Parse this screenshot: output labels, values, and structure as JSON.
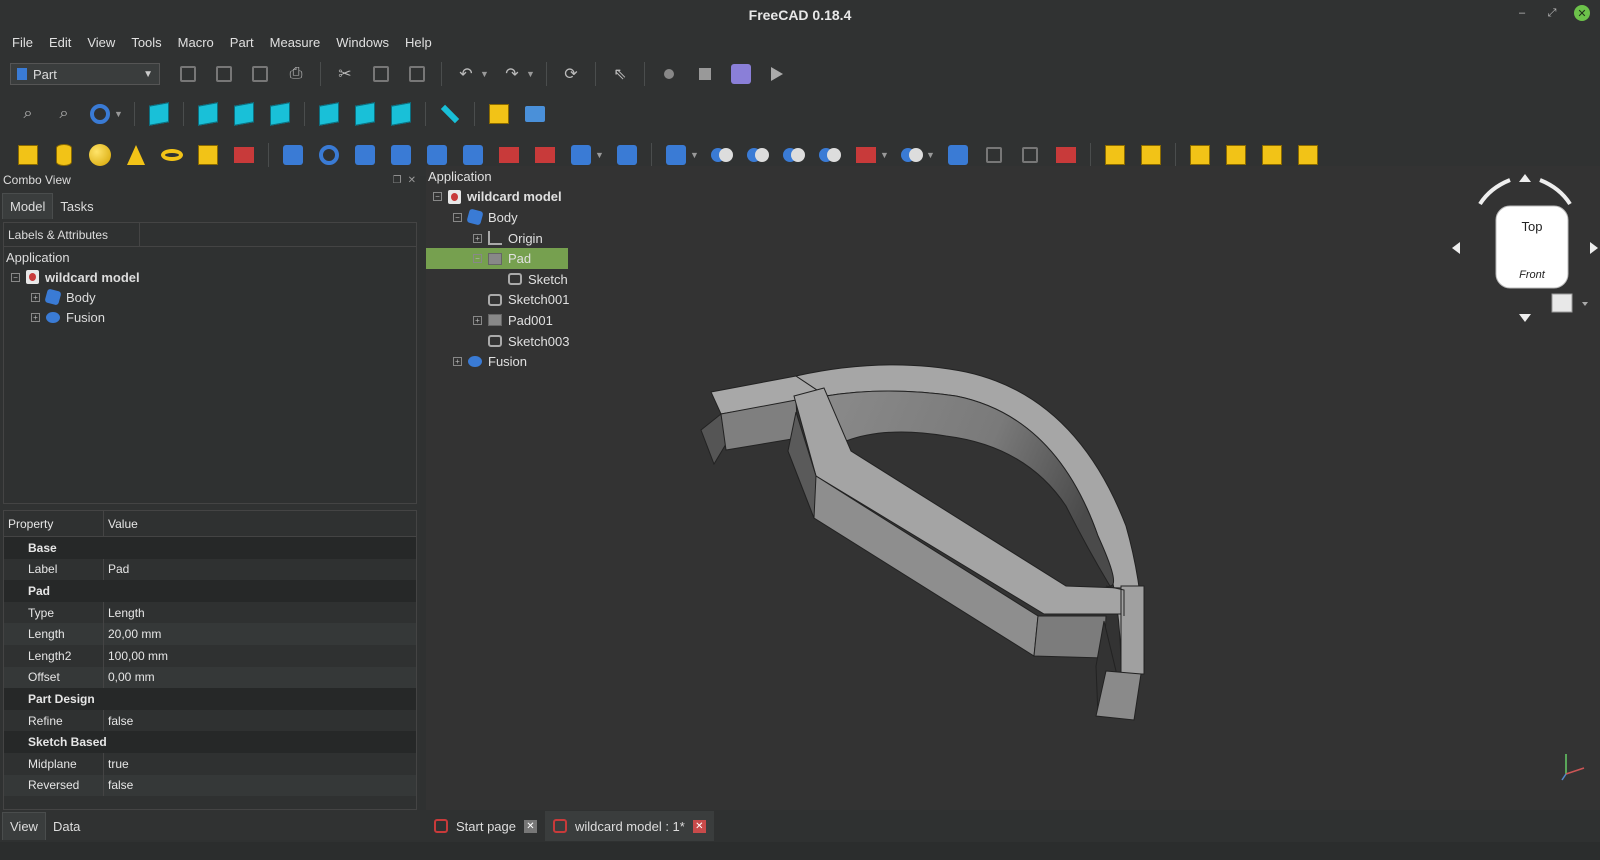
{
  "window": {
    "title": "FreeCAD 0.18.4"
  },
  "menu": [
    "File",
    "Edit",
    "View",
    "Tools",
    "Macro",
    "Part",
    "Measure",
    "Windows",
    "Help"
  ],
  "toolbar": {
    "workbench": "Part"
  },
  "combo": {
    "title": "Combo View",
    "tabs": [
      "Model",
      "Tasks"
    ],
    "tree_header": "Labels & Attributes",
    "tree_root": "Application",
    "tree": [
      {
        "label": "wildcard model",
        "level": 0,
        "bold": true
      },
      {
        "label": "Body",
        "level": 1
      },
      {
        "label": "Fusion",
        "level": 1
      }
    ],
    "prop_header": {
      "property": "Property",
      "value": "Value"
    },
    "groups": {
      "base": "Base",
      "pad": "Pad",
      "part_design": "Part Design",
      "sketch_based": "Sketch Based"
    },
    "props": {
      "label": {
        "name": "Label",
        "value": "Pad"
      },
      "type": {
        "name": "Type",
        "value": "Length"
      },
      "length": {
        "name": "Length",
        "value": "20,00 mm"
      },
      "length2": {
        "name": "Length2",
        "value": "100,00 mm"
      },
      "offset": {
        "name": "Offset",
        "value": "0,00 mm"
      },
      "refine": {
        "name": "Refine",
        "value": "false"
      },
      "midplane": {
        "name": "Midplane",
        "value": "true"
      },
      "reversed": {
        "name": "Reversed",
        "value": "false"
      }
    },
    "bottom_tabs": [
      "View",
      "Data"
    ]
  },
  "view_tree": {
    "root": "Application",
    "doc": "wildcard model",
    "body": "Body",
    "origin": "Origin",
    "pad": "Pad",
    "sketch": "Sketch",
    "sketch001": "Sketch001",
    "pad001": "Pad001",
    "sketch003": "Sketch003",
    "fusion": "Fusion"
  },
  "navcube": {
    "top": "Top",
    "front": "Front"
  },
  "doc_tabs": [
    "Start page",
    "wildcard model : 1*"
  ]
}
